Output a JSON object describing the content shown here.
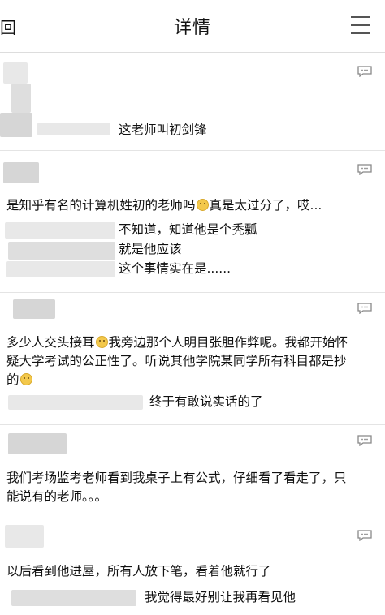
{
  "header": {
    "back_label": "回",
    "title": "详情"
  },
  "comments": [
    {
      "lines": [
        "这老师叫初剑锋"
      ]
    },
    {
      "text_before_emoji": "是知乎有名的计算机姓初的老师吗",
      "text_after_emoji": "真是太过分了，哎...",
      "replies": [
        "不知道，知道他是个秃瓢",
        "就是他应该",
        "这个事情实在是......"
      ]
    },
    {
      "line1_before_emoji": "多少人交头接耳",
      "line1_after_emoji": "我旁边那个人明目张胆作弊呢。我都开始怀",
      "line2": "疑大学考试的公正性了。听说其他学院某同学所有科目都是抄",
      "line3": "的",
      "reply": "终于有敢说实话的了"
    },
    {
      "line1": "我们考场监考老师看到我桌子上有公式，仔细看了看走了，只",
      "line2": "能说有的老师。。。"
    },
    {
      "line1": "以后看到他进屋，所有人放下笔，看着他就行了",
      "reply": "我觉得最好别让我再看见他"
    }
  ]
}
